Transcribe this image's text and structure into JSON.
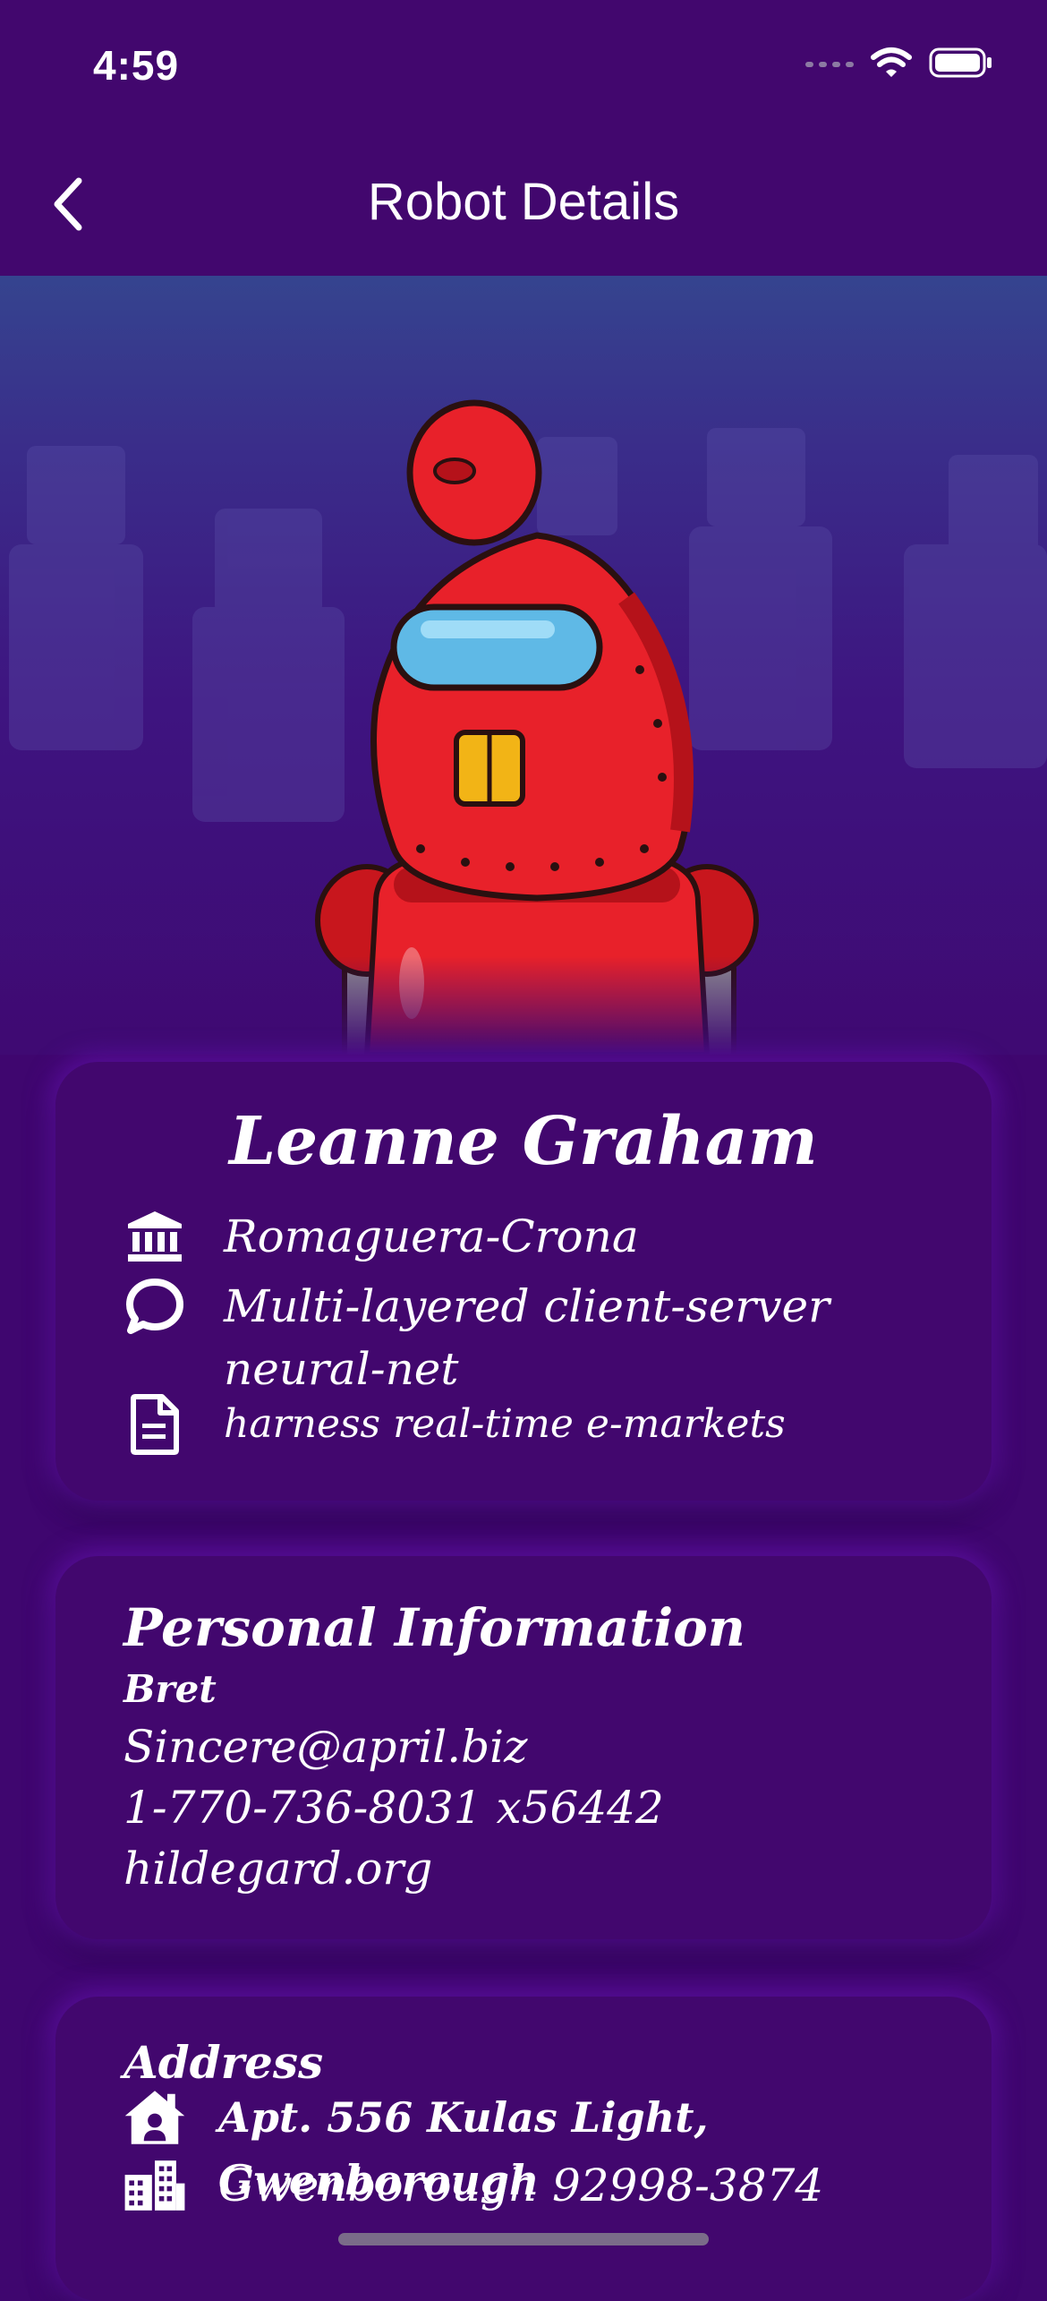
{
  "status_bar": {
    "time": "4:59",
    "signal_icon": "signal-dots-icon",
    "wifi_icon": "wifi-icon",
    "battery_icon": "battery-icon"
  },
  "nav": {
    "back_icon": "chevron-left-icon",
    "title": "Robot Details"
  },
  "hero": {
    "image": "red-robot-illustration",
    "background": "robot-silhouettes"
  },
  "profile": {
    "name": "Leanne Graham",
    "company": {
      "icon": "bank-icon",
      "text": "Romaguera-Crona"
    },
    "catch_phrase": {
      "icon": "chat-bubble-icon",
      "text": "Multi-layered client-server neural-net"
    },
    "bs": {
      "icon": "document-icon",
      "text": "harness real-time e-markets"
    }
  },
  "personal": {
    "title": "Personal Information",
    "username": "Bret",
    "email": "Sincere@april.biz",
    "phone": "1-770-736-8031 x56442",
    "website": "hildegard.org"
  },
  "address": {
    "title": "Address",
    "street": {
      "icon": "house-icon",
      "text": "Apt. 556 Kulas Light, Gwenborough"
    },
    "city": {
      "icon": "city-icon",
      "text": "Gwenborough 92998-3874"
    }
  },
  "colors": {
    "background": "#3f066f",
    "card": "#42076e",
    "text": "#ffffff",
    "robot_red": "#e8212a"
  }
}
